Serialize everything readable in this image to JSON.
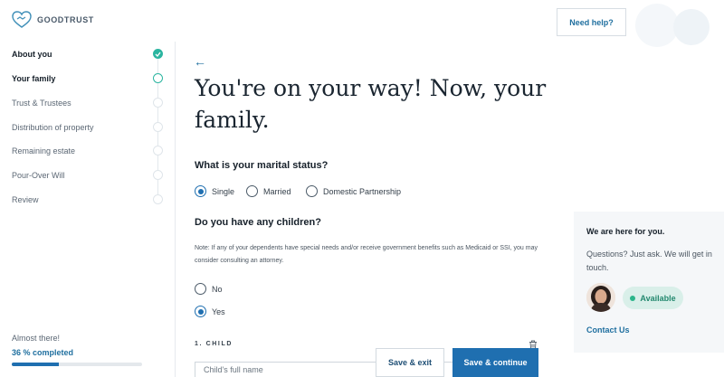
{
  "header": {
    "logo_text": "GOODTRUST",
    "help_button": "Need help?"
  },
  "sidebar": {
    "items": [
      {
        "label": "About you",
        "state": "done"
      },
      {
        "label": "Your family",
        "state": "current"
      },
      {
        "label": "Trust & Trustees",
        "state": "todo"
      },
      {
        "label": "Distribution of property",
        "state": "todo"
      },
      {
        "label": "Remaining estate",
        "state": "todo"
      },
      {
        "label": "Pour-Over Will",
        "state": "todo"
      },
      {
        "label": "Review",
        "state": "todo"
      }
    ],
    "progress_caption": "Almost there!",
    "progress_text": "36 % completed",
    "progress_value": 0.36
  },
  "main": {
    "title": "You're on your way! Now, your family.",
    "marital_question": "What is your marital status?",
    "marital_options": [
      {
        "label": "Single",
        "checked": true
      },
      {
        "label": "Married",
        "checked": false
      },
      {
        "label": "Domestic Partnership",
        "checked": false
      }
    ],
    "children_question": "Do you have any children?",
    "children_note": "Note: If any of your dependents have special needs and/or receive government benefits such as Medicaid or SSI, you may consider consulting an attorney.",
    "children_options": [
      {
        "label": "No",
        "checked": false
      },
      {
        "label": "Yes",
        "checked": true
      }
    ],
    "child_section_label": "1. CHILD",
    "child_name_placeholder": "Child's full name",
    "save_exit": "Save & exit",
    "save_continue": "Save & continue"
  },
  "help_panel": {
    "title": "We are here for you.",
    "body": "Questions? Just ask. We will get in touch.",
    "status": "Available",
    "link": "Contact Us"
  },
  "colors": {
    "accent": "#1f6fb0",
    "teal": "#2bb5a0",
    "available_bg": "#d9efe9"
  }
}
